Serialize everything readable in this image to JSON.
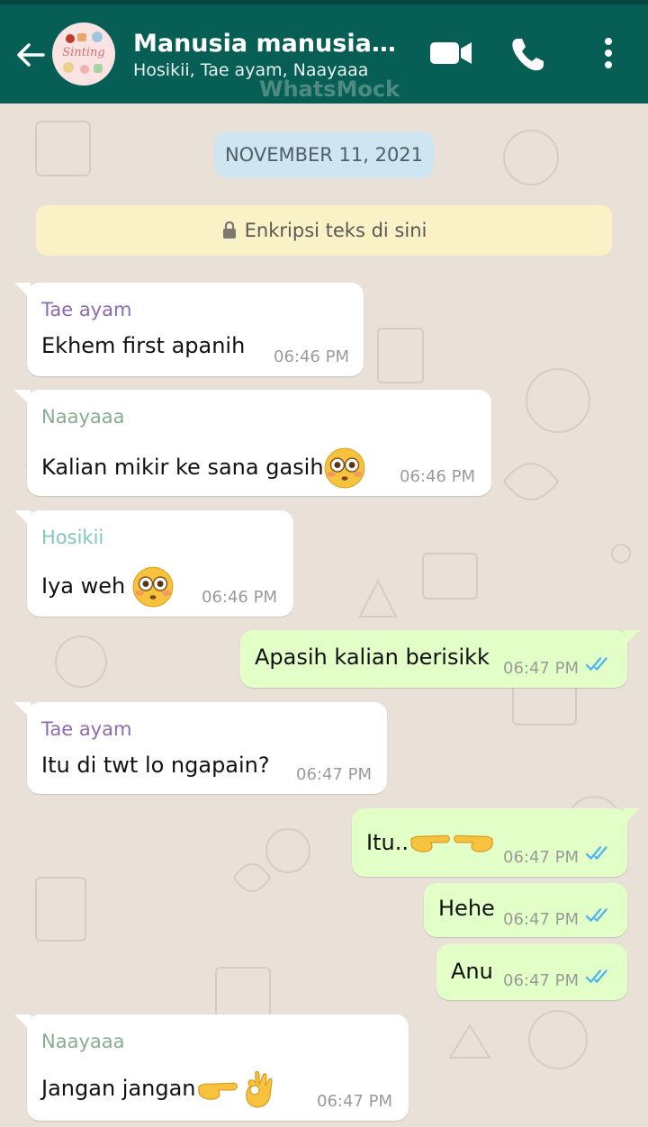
{
  "header": {
    "title": "Manusia manusia ku…",
    "subtitle": "Hosikii, Tae ayam, Naayaaa",
    "avatar_text": "Sinting",
    "watermark": "WhatsMock",
    "color": "#075e54"
  },
  "date_chip": "NOVEMBER 11, 2021",
  "encryption_notice": "Enkripsi teks di sini",
  "icons": {
    "back": "arrow-left-icon",
    "video": "video-camera-icon",
    "call": "phone-icon",
    "menu": "more-vertical-icon",
    "lock": "lock-icon",
    "read": "double-check-icon"
  },
  "colors": {
    "sender_tae": "#8c6bb1",
    "sender_naa": "#86ad90",
    "sender_hos": "#7fc7c1",
    "read_tick": "#4fb3f0",
    "outgoing_bubble": "#e2ffc7"
  },
  "messages": [
    {
      "sender": "Tae ayam",
      "text": "Ekhem first apanih",
      "time": "06:46 PM"
    },
    {
      "sender": "Naayaaa",
      "text": "Kalian mikir ke sana gasih",
      "emoji": "flushed-face-emoji",
      "time": "06:46 PM"
    },
    {
      "sender": "Hosikii",
      "text": "Iya weh ",
      "emoji": "flushed-face-emoji",
      "time": "06:46 PM"
    },
    {
      "sender": "",
      "text": "Apasih kalian berisikk",
      "time": "06:47 PM"
    },
    {
      "sender": "Tae ayam",
      "text": "Itu di twt lo ngapain?",
      "time": "06:47 PM"
    },
    {
      "sender": "",
      "text": "Itu..",
      "emoji": "pointing-fingers-emoji",
      "time": "06:47 PM"
    },
    {
      "sender": "",
      "text": "Hehe",
      "time": "06:47 PM"
    },
    {
      "sender": "",
      "text": "Anu",
      "time": "06:47 PM"
    },
    {
      "sender": "Naayaaa",
      "text": "Jangan jangan",
      "emoji": "pointing-ok-hand-emoji",
      "time": "06:47 PM"
    }
  ]
}
